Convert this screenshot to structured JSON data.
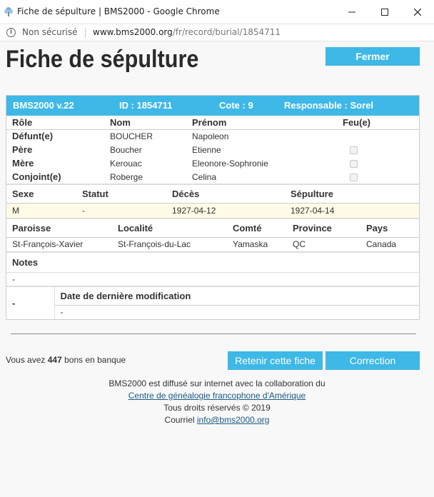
{
  "window": {
    "title": "Fiche de sépulture | BMS2000 - Google Chrome",
    "security": "Non sécurisé",
    "url_host": "www.bms2000.org",
    "url_path": "/fr/record/burial/1854711"
  },
  "page": {
    "title": "Fiche de sépulture",
    "close_label": "Fermer"
  },
  "record_header": {
    "version": "BMS2000 v.22",
    "id": "ID : 1854711",
    "cote": "Cote : 9",
    "responsable": "Responsable : Sorel"
  },
  "persons": {
    "headers": [
      "Rôle",
      "Nom",
      "Prénom",
      "Feu(e)"
    ],
    "rows": [
      {
        "role": "Défunt(e)",
        "nom": "BOUCHER",
        "prenom": "Napoleon",
        "has_check": false
      },
      {
        "role": "Père",
        "nom": "Boucher",
        "prenom": "Etienne",
        "has_check": true
      },
      {
        "role": "Mère",
        "nom": "Kerouac",
        "prenom": "Eleonore-Sophronie",
        "has_check": true
      },
      {
        "role": "Conjoint(e)",
        "nom": "Roberge",
        "prenom": "Celina",
        "has_check": true
      }
    ]
  },
  "details": {
    "headers": [
      "Sexe",
      "Statut",
      "Décès",
      "Sépulture"
    ],
    "values": [
      "M",
      "-",
      "1927-04-12",
      "1927-04-14"
    ]
  },
  "location": {
    "headers": [
      "Paroisse",
      "Localité",
      "Comté",
      "Province",
      "Pays"
    ],
    "values": [
      "St-François-Xavier",
      "St-François-du-Lac",
      "Yamaska",
      "QC",
      "Canada"
    ]
  },
  "notes": {
    "label": "Notes",
    "value": "-"
  },
  "modification": {
    "left_value": "-",
    "label": "Date de dernière modification",
    "value": "-"
  },
  "bank": {
    "prefix": "Vous avez",
    "count": "447",
    "suffix": "bons en banque"
  },
  "actions": {
    "retain_label": "Retenir cette fiche",
    "correction_label": "Correction"
  },
  "footer": {
    "line1": "BMS2000 est diffusé sur internet avec la collaboration du",
    "link": "Centre de généalogie francophone d'Amérique",
    "line3": "Tous droits réservés © 2019",
    "contact_prefix": "Courriel",
    "email": "info@bms2000.org"
  }
}
